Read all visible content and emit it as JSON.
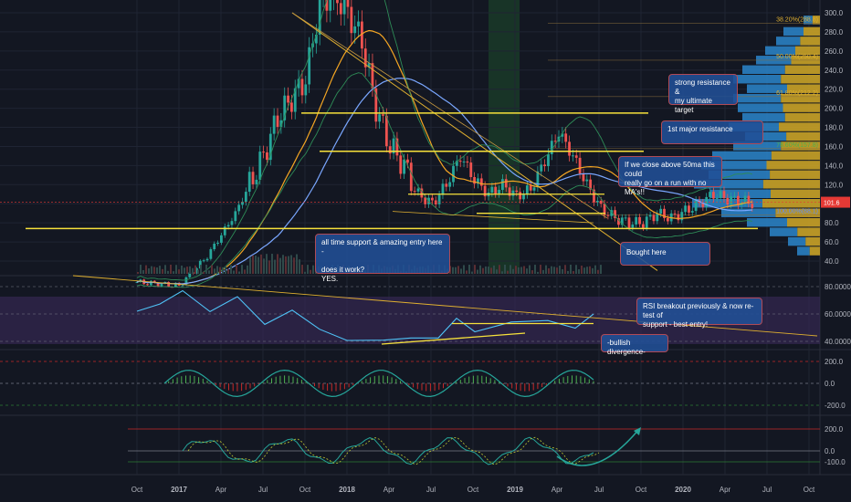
{
  "colors": {
    "background": "#131722",
    "grid": "#1f2433",
    "candle_up": "#26a69a",
    "candle_down": "#ef5350",
    "support_line": "#f7e23b",
    "rsi_line": "#4fc3f7",
    "rsi_band": "#3a2a5a",
    "ma_orange": "#f5a623",
    "ma_blue": "#7aa7ff",
    "bb_green": "#2e8b57",
    "note_fill": "#215096",
    "note_border": "#b04a56",
    "price_badge": "#e53935",
    "highlight_zone": "#1e4d2b"
  },
  "price_axis": {
    "ticks": [
      "300.0",
      "280.0",
      "260.0",
      "240.0",
      "220.0",
      "200.0",
      "180.0",
      "160.0",
      "140.0",
      "120.0",
      "100.0",
      "80.0",
      "60.0",
      "40.0"
    ],
    "current_price": "101.6"
  },
  "rsi_axis": {
    "ticks": [
      "80.0000",
      "60.0000",
      "40.0000"
    ]
  },
  "macd_axis": {
    "ticks": [
      "200.0",
      "0.0",
      "-200.0"
    ]
  },
  "osc_axis": {
    "ticks": [
      "200.0",
      "0.0",
      "-100.0"
    ]
  },
  "time_axis": {
    "labels": [
      "Oct",
      "2017",
      "Apr",
      "Jul",
      "Oct",
      "2018",
      "Apr",
      "Jul",
      "Oct",
      "2019",
      "Apr",
      "Jul",
      "Oct",
      "2020",
      "Apr",
      "Jul",
      "Oct"
    ]
  },
  "fib_levels": [
    {
      "label": "38.20%(288.8)",
      "value": 288.8
    },
    {
      "label": "50.00%(250.4)",
      "value": 250.4
    },
    {
      "label": "61.80%(212.2)",
      "value": 212.2
    },
    {
      "label": "78.60%(157.8)",
      "value": 157.8
    },
    {
      "label": "100.00%(88.1)",
      "value": 88.1
    }
  ],
  "annotations": {
    "ultimate_target": "strong resistance &\nmy ultimate target",
    "major_resistance": "1st major resistance",
    "fifty_ma": "If we close above 50ma this could\nreally go on a run with no MA's!!",
    "bought_here": "Bought here",
    "ath_support": "all time support & amazing entry here -\n\ndoes it work?\nYES.",
    "rsi_breakout": "RSI breakout previously & now re-test of\nsupport - best entry!",
    "bullish_divergence": "-bullish divergence-"
  },
  "chart_data": {
    "type": "line",
    "series": [],
    "price_levels": [
      {
        "value": 195,
        "note": "strong resistance & my ultimate target"
      },
      {
        "value": 155,
        "note": "1st major resistance"
      },
      {
        "value": 74
      }
    ],
    "rsi_levels": [
      80,
      60,
      40
    ],
    "current_price": 101.6
  }
}
